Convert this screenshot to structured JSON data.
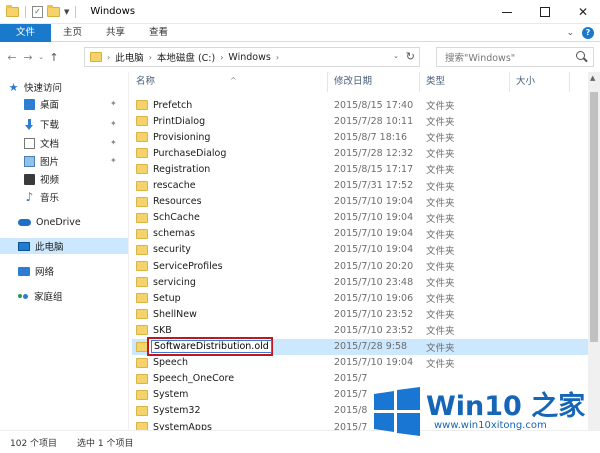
{
  "window": {
    "title": "Windows",
    "minimize": "—",
    "maximize": "□",
    "close": "✕"
  },
  "ribbon": {
    "tabs": [
      "文件",
      "主页",
      "共享",
      "查看"
    ]
  },
  "address": {
    "crumbs": [
      "此电脑",
      "本地磁盘 (C:)",
      "Windows"
    ],
    "search_placeholder": "搜索\"Windows\""
  },
  "nav": {
    "quick_access": "快速访问",
    "items": [
      {
        "label": "桌面",
        "icon": "desktop-icon"
      },
      {
        "label": "下载",
        "icon": "download-icon"
      },
      {
        "label": "文档",
        "icon": "document-icon"
      },
      {
        "label": "图片",
        "icon": "picture-icon"
      },
      {
        "label": "视频",
        "icon": "video-icon"
      },
      {
        "label": "音乐",
        "icon": "music-icon"
      }
    ],
    "onedrive": "OneDrive",
    "this_pc": "此电脑",
    "network": "网络",
    "homegroup": "家庭组"
  },
  "columns": {
    "name": "名称",
    "date": "修改日期",
    "type": "类型",
    "size": "大小"
  },
  "files": [
    {
      "name": "Prefetch",
      "date": "2015/8/15 17:40",
      "type": "文件夹"
    },
    {
      "name": "PrintDialog",
      "date": "2015/7/28 10:11",
      "type": "文件夹"
    },
    {
      "name": "Provisioning",
      "date": "2015/8/7 18:16",
      "type": "文件夹"
    },
    {
      "name": "PurchaseDialog",
      "date": "2015/7/28 12:32",
      "type": "文件夹"
    },
    {
      "name": "Registration",
      "date": "2015/8/15 17:17",
      "type": "文件夹"
    },
    {
      "name": "rescache",
      "date": "2015/7/31 17:52",
      "type": "文件夹"
    },
    {
      "name": "Resources",
      "date": "2015/7/10 19:04",
      "type": "文件夹"
    },
    {
      "name": "SchCache",
      "date": "2015/7/10 19:04",
      "type": "文件夹"
    },
    {
      "name": "schemas",
      "date": "2015/7/10 19:04",
      "type": "文件夹"
    },
    {
      "name": "security",
      "date": "2015/7/10 19:04",
      "type": "文件夹"
    },
    {
      "name": "ServiceProfiles",
      "date": "2015/7/10 20:20",
      "type": "文件夹"
    },
    {
      "name": "servicing",
      "date": "2015/7/10 23:48",
      "type": "文件夹"
    },
    {
      "name": "Setup",
      "date": "2015/7/10 19:06",
      "type": "文件夹"
    },
    {
      "name": "ShellNew",
      "date": "2015/7/10 23:52",
      "type": "文件夹"
    },
    {
      "name": "SKB",
      "date": "2015/7/10 23:52",
      "type": "文件夹"
    },
    {
      "name": "SoftwareDistribution.old",
      "date": "2015/7/28 9:58",
      "type": "文件夹"
    },
    {
      "name": "Speech",
      "date": "2015/7/10 19:04",
      "type": "文件夹"
    },
    {
      "name": "Speech_OneCore",
      "date": "2015/7",
      "type": ""
    },
    {
      "name": "System",
      "date": "2015/7",
      "type": ""
    },
    {
      "name": "System32",
      "date": "2015/8",
      "type": ""
    },
    {
      "name": "SystemApps",
      "date": "2015/7",
      "type": ""
    }
  ],
  "status": {
    "count": "102 个项目",
    "selected": "选中 1 个项目"
  },
  "watermark": {
    "brand": "Win10 之家",
    "site": "www.win10xitong.com"
  }
}
